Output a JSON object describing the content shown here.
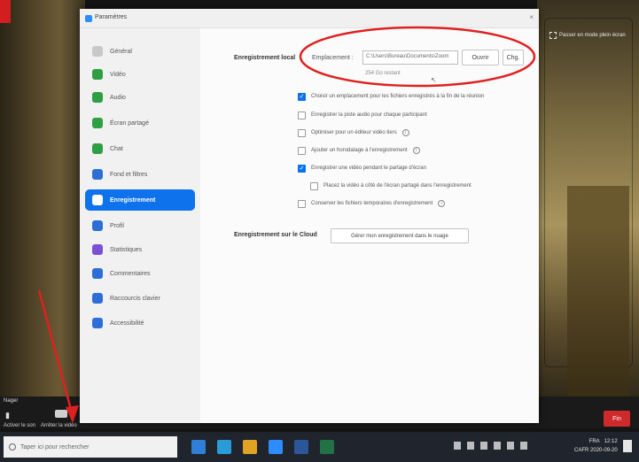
{
  "window": {
    "title": "Paramètres",
    "close_glyph": "×"
  },
  "video": {
    "fullscreen_label": "Passer en mode plein écran"
  },
  "sidebar": {
    "items": [
      {
        "label": "Général",
        "icon": "gear-icon",
        "color": "#c8c8c8"
      },
      {
        "label": "Vidéo",
        "icon": "video-icon",
        "color": "#2ea043"
      },
      {
        "label": "Audio",
        "icon": "headphones-icon",
        "color": "#2ea043"
      },
      {
        "label": "Écran partagé",
        "icon": "share-screen-icon",
        "color": "#2ea043"
      },
      {
        "label": "Chat",
        "icon": "chat-icon",
        "color": "#2ea043"
      },
      {
        "label": "Fond et filtres",
        "icon": "background-icon",
        "color": "#2d6ed6"
      },
      {
        "label": "Enregistrement",
        "icon": "record-icon",
        "color": "#ffffff",
        "active": true
      },
      {
        "label": "Profil",
        "icon": "profile-icon",
        "color": "#2d6ed6"
      },
      {
        "label": "Statistiques",
        "icon": "stats-icon",
        "color": "#7b4fd6"
      },
      {
        "label": "Commentaires",
        "icon": "feedback-icon",
        "color": "#2d6ed6"
      },
      {
        "label": "Raccourcis clavier",
        "icon": "keyboard-icon",
        "color": "#2d6ed6"
      },
      {
        "label": "Accessibilité",
        "icon": "accessibility-icon",
        "color": "#2d6ed6"
      }
    ]
  },
  "recording": {
    "local_label": "Enregistrement local",
    "location_label": "Emplacement :",
    "path_value": "C:\\Users\\Bureau\\Documents\\Zoom",
    "open_button": "Ouvrir",
    "change_button": "Chg.",
    "free_space": "254 Go restant",
    "options": [
      {
        "label": "Choisir un emplacement pour les fichiers enregistrés à la fin de la réunion",
        "checked": true,
        "info": false,
        "indent": false
      },
      {
        "label": "Enregistrer la piste audio pour chaque participant",
        "checked": false,
        "info": false,
        "indent": false
      },
      {
        "label": "Optimiser pour un éditeur vidéo tiers",
        "checked": false,
        "info": true,
        "indent": false
      },
      {
        "label": "Ajouter un horodatage à l'enregistrement",
        "checked": false,
        "info": true,
        "indent": false
      },
      {
        "label": "Enregistrer une vidéo pendant le partage d'écran",
        "checked": true,
        "info": false,
        "indent": false
      },
      {
        "label": "Placez la vidéo à côté de l'écran partagé dans l'enregistrement",
        "checked": false,
        "info": false,
        "indent": true
      },
      {
        "label": "Conserver les fichiers temporaires d'enregistrement",
        "checked": false,
        "info": true,
        "indent": false
      }
    ],
    "cloud_label": "Enregistrement sur le Cloud",
    "cloud_button": "Gérer mon enregistrement dans le nuage"
  },
  "meeting_bar": {
    "left_label": "Nager",
    "mute_label": "Activer le son",
    "video_label": "Arrêter la vidéo",
    "end_label": "Fin"
  },
  "taskbar": {
    "search_placeholder": "Taper ici pour rechercher",
    "apps": [
      {
        "icon": "file-explorer-icon",
        "color": "#2f7fd8"
      },
      {
        "icon": "edge-icon",
        "color": "#2a9bd8"
      },
      {
        "icon": "chrome-icon",
        "color": "#e0a323"
      },
      {
        "icon": "zoom-icon",
        "color": "#2d8cff"
      },
      {
        "icon": "word-icon",
        "color": "#2b579a"
      },
      {
        "icon": "excel-icon",
        "color": "#217346"
      }
    ],
    "lang_top": "FRA",
    "lang_bottom": "CAFR",
    "time": "12:12",
    "date": "2020-09-20"
  },
  "annotations": {
    "highlight_color": "#e02020"
  }
}
